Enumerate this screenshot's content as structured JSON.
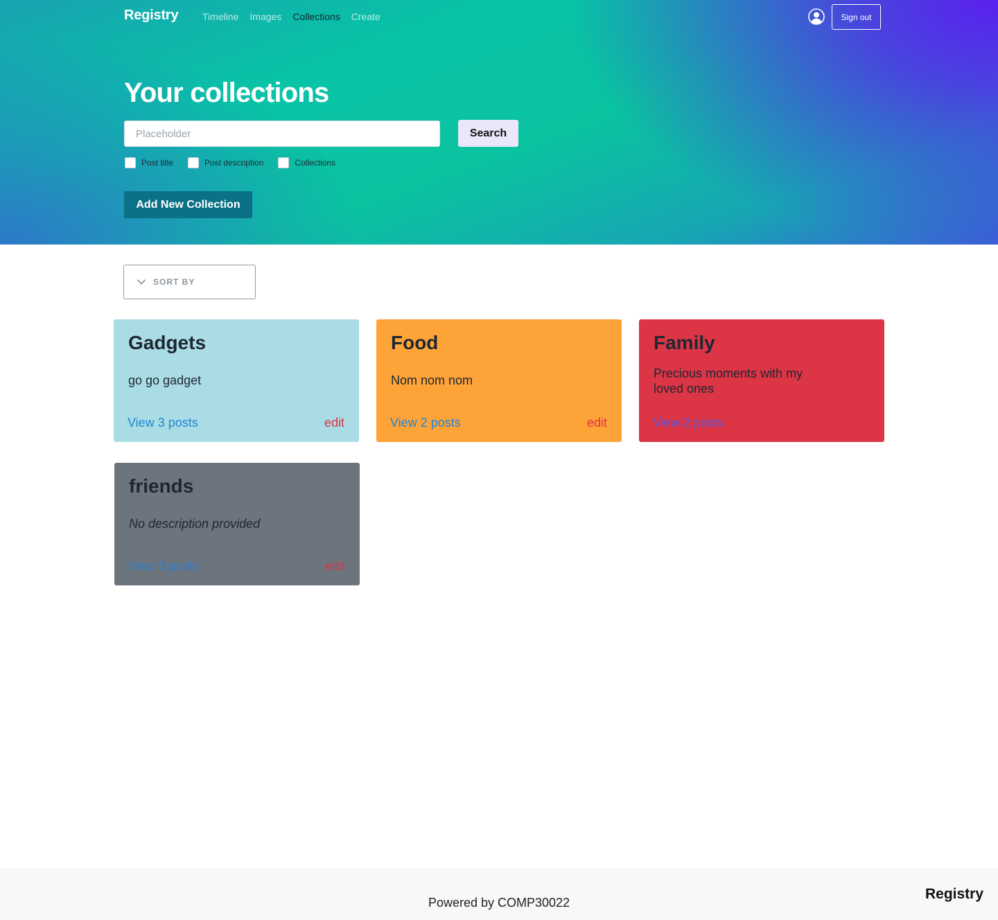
{
  "nav": {
    "brand": "Registry",
    "links": [
      {
        "label": "Timeline",
        "active": false
      },
      {
        "label": "Images",
        "active": false
      },
      {
        "label": "Collections",
        "active": true
      },
      {
        "label": "Create",
        "active": false
      }
    ],
    "user_icon": "user-circle-icon",
    "signout_label": "Sign out"
  },
  "hero": {
    "title": "Your collections",
    "search_placeholder": "Placeholder",
    "search_value": "",
    "search_button": "Search",
    "filters": [
      {
        "label": "Post title",
        "checked": false
      },
      {
        "label": "Post description",
        "checked": false
      },
      {
        "label": "Collections",
        "checked": false
      }
    ],
    "add_button": "Add New Collection"
  },
  "sort": {
    "icon": "chevron-down-icon",
    "label": "SORT BY"
  },
  "collections": [
    {
      "title": "Gadgets",
      "description": "go go gadget",
      "italic": false,
      "view_label": "View 3 posts",
      "edit_label": "edit",
      "color": "#aadce5"
    },
    {
      "title": "Food",
      "description": "Nom nom nom",
      "italic": false,
      "view_label": "View 2 posts",
      "edit_label": "edit",
      "color": "#fea337"
    },
    {
      "title": "Family",
      "description": "Precious moments with my loved ones",
      "italic": false,
      "view_label": "View 2 posts",
      "edit_label": "",
      "color": "#dc3545"
    },
    {
      "title": "friends",
      "description": "No description provided",
      "italic": true,
      "view_label": "View 3 posts",
      "edit_label": "edit",
      "color": "#6c757d"
    }
  ],
  "footer": {
    "text": "Powered by COMP30022",
    "brand": "Registry"
  },
  "colors": {
    "accent": "#0b7186",
    "link": "#1f86d6",
    "danger": "#dc3545"
  }
}
